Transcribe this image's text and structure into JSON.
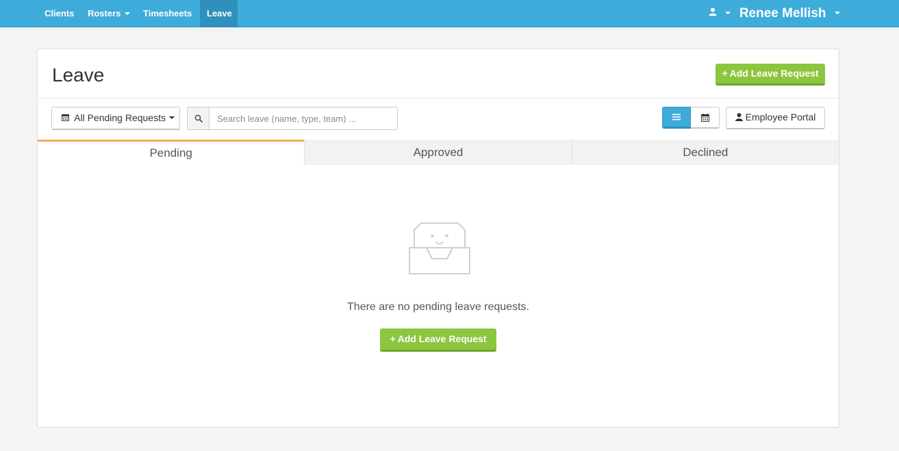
{
  "nav": {
    "items": [
      {
        "label": "Clients"
      },
      {
        "label": "Rosters"
      },
      {
        "label": "Timesheets"
      },
      {
        "label": "Leave"
      }
    ],
    "user_name": "Renee Mellish"
  },
  "page": {
    "title": "Leave",
    "add_button_label": "Add Leave Request"
  },
  "toolbar": {
    "filter_label": "All Pending Requests",
    "search_placeholder": "Search leave (name, type, team) ...",
    "employee_portal_label": "Employee Portal"
  },
  "tabs": [
    {
      "label": "Pending"
    },
    {
      "label": "Approved"
    },
    {
      "label": "Declined"
    }
  ],
  "empty_state": {
    "message": "There are no pending leave requests.",
    "button_label": "Add Leave Request"
  },
  "colors": {
    "nav_bg": "#3eacdb",
    "primary_green": "#8cc63f",
    "active_tab_accent": "#f5a95b"
  }
}
